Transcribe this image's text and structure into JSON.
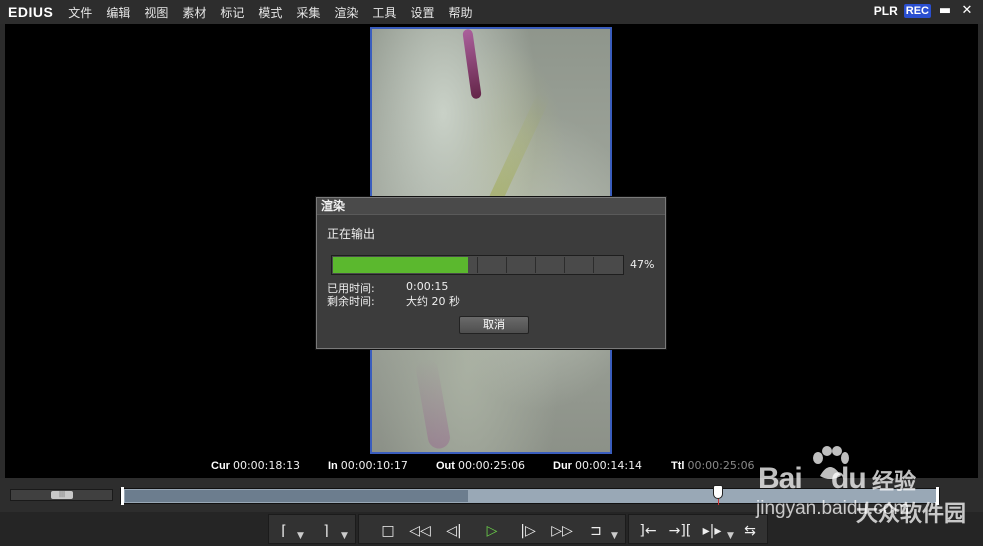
{
  "app": {
    "logo": "EDIUS"
  },
  "menu": [
    "文件",
    "编辑",
    "视图",
    "素材",
    "标记",
    "模式",
    "采集",
    "渲染",
    "工具",
    "设置",
    "帮助"
  ],
  "mode": {
    "plr": "PLR",
    "rec": "REC"
  },
  "window_buttons": {
    "minimize": "▬",
    "close": "✕"
  },
  "dialog": {
    "title": "渲染",
    "status": "正在输出",
    "progress_percent": 47,
    "progress_label": "47%",
    "elapsed_label": "已用时间:",
    "elapsed_value": "0:00:15",
    "remaining_label": "剩余时间:",
    "remaining_value": "大约 20 秒",
    "cancel_label": "取消"
  },
  "timecodes": {
    "cur_label": "Cur",
    "cur": "00:00:18:13",
    "in_label": "In",
    "in": "00:00:10:17",
    "out_label": "Out",
    "out": "00:00:25:06",
    "dur_label": "Dur",
    "dur": "00:00:14:14",
    "ttl_label": "Ttl",
    "ttl": "00:00:25:06"
  },
  "timeline": {
    "playhead_fraction": 0.73
  },
  "transport": {
    "set_in": "⌈",
    "set_out": "⌉",
    "stop": "□",
    "rewind": "◁◁",
    "step_back": "◁|",
    "play": "▷",
    "step_forward": "|▷",
    "fast_forward": "▷▷",
    "loop": "⊐",
    "insert": "]←",
    "overwrite": "→][",
    "split": "▸|▸",
    "output": "⇆"
  },
  "watermark": {
    "logo": "Bai",
    "logo2": "du",
    "jingyan": "经验",
    "url": "jingyan.baidu.com",
    "site": "大众软件园"
  },
  "colors": {
    "progress": "#5bb82e",
    "rec_badge": "#2a4fd0",
    "play": "#6bd14a",
    "video_border": "#3a5dbd"
  },
  "icons": [
    "in-point-icon",
    "out-point-icon",
    "stop-icon",
    "rewind-icon",
    "step-back-icon",
    "play-icon",
    "step-forward-icon",
    "fast-forward-icon",
    "loop-icon",
    "insert-icon",
    "overwrite-icon",
    "split-icon",
    "output-icon"
  ]
}
